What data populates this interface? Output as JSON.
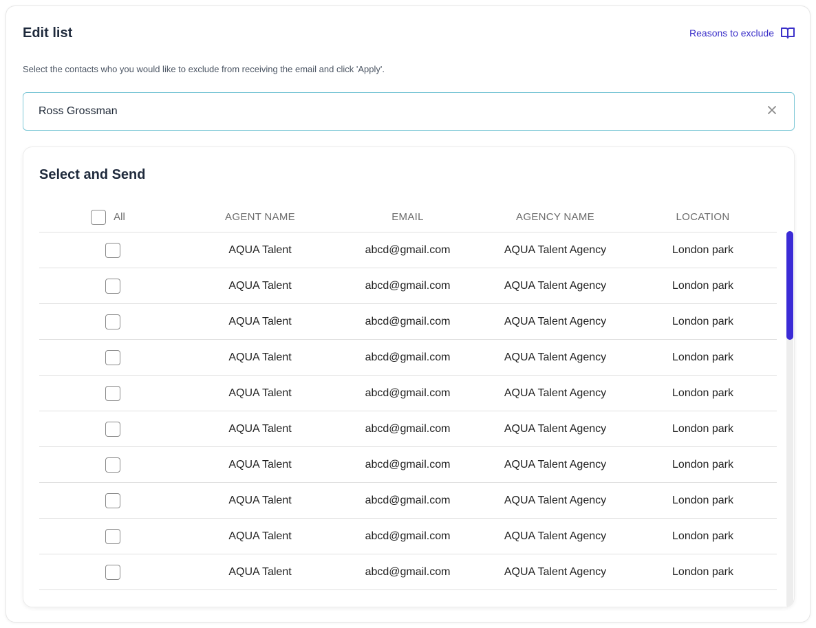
{
  "header": {
    "title": "Edit list",
    "reasons_link": "Reasons to exclude",
    "reasons_icon": "book-open-icon",
    "accent_color": "#3b30c9"
  },
  "description": "Select the contacts who you would like to exclude from receiving the email and click 'Apply'.",
  "search": {
    "value": "Ross Grossman",
    "clear_icon": "close-icon"
  },
  "table_section": {
    "title": "Select and Send",
    "columns": {
      "select_all": "All",
      "agent_name": "AGENT NAME",
      "email": "EMAIL",
      "agency_name": "AGENCY NAME",
      "location": "LOCATION"
    },
    "rows": [
      {
        "agent_name": "AQUA Talent",
        "email": "abcd@gmail.com",
        "agency_name": "AQUA Talent Agency",
        "location": "London park"
      },
      {
        "agent_name": "AQUA Talent",
        "email": "abcd@gmail.com",
        "agency_name": "AQUA Talent Agency",
        "location": "London park"
      },
      {
        "agent_name": "AQUA Talent",
        "email": "abcd@gmail.com",
        "agency_name": "AQUA Talent Agency",
        "location": "London park"
      },
      {
        "agent_name": "AQUA Talent",
        "email": "abcd@gmail.com",
        "agency_name": "AQUA Talent Agency",
        "location": "London park"
      },
      {
        "agent_name": "AQUA Talent",
        "email": "abcd@gmail.com",
        "agency_name": "AQUA Talent Agency",
        "location": "London park"
      },
      {
        "agent_name": "AQUA Talent",
        "email": "abcd@gmail.com",
        "agency_name": "AQUA Talent Agency",
        "location": "London park"
      },
      {
        "agent_name": "AQUA Talent",
        "email": "abcd@gmail.com",
        "agency_name": "AQUA Talent Agency",
        "location": "London park"
      },
      {
        "agent_name": "AQUA Talent",
        "email": "abcd@gmail.com",
        "agency_name": "AQUA Talent Agency",
        "location": "London park"
      },
      {
        "agent_name": "AQUA Talent",
        "email": "abcd@gmail.com",
        "agency_name": "AQUA Talent Agency",
        "location": "London park"
      },
      {
        "agent_name": "AQUA Talent",
        "email": "abcd@gmail.com",
        "agency_name": "AQUA Talent Agency",
        "location": "London park"
      }
    ]
  },
  "scrollbar_color": "#3b2bd6"
}
